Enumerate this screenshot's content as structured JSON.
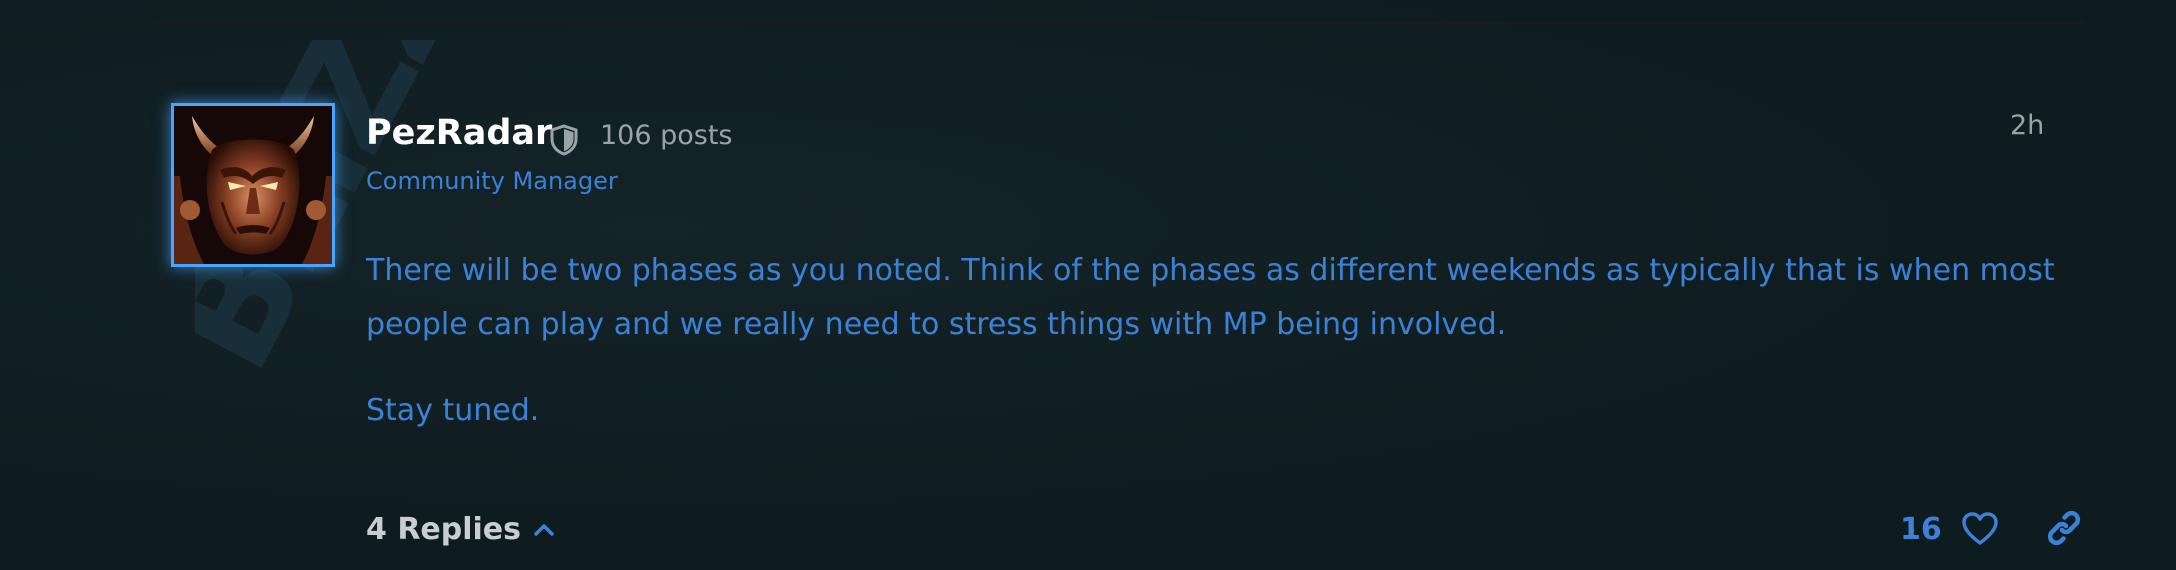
{
  "post": {
    "author": {
      "username": "PezRadar",
      "post_count": "106 posts",
      "title": "Community Manager",
      "badge_icon": "shield-icon",
      "avatar_glow_color": "#4aa3ff"
    },
    "time": "2h",
    "body": [
      "There will be two phases as you noted. Think of the phases as different weekends as typically that is when most people can play and we really need to stress things with MP being involved.",
      "Stay tuned."
    ],
    "footer": {
      "replies_label": "4 Replies",
      "replies_icon": "chevron-up-icon",
      "likes_count": "16",
      "like_icon": "heart-icon",
      "share_icon": "link-icon"
    }
  },
  "watermark": {
    "text": "BLIZZARD"
  },
  "colors": {
    "background": "#0f1c1f",
    "accent_blue": "#3b82d6",
    "username": "#ffffff",
    "muted": "#9aa3a6"
  }
}
